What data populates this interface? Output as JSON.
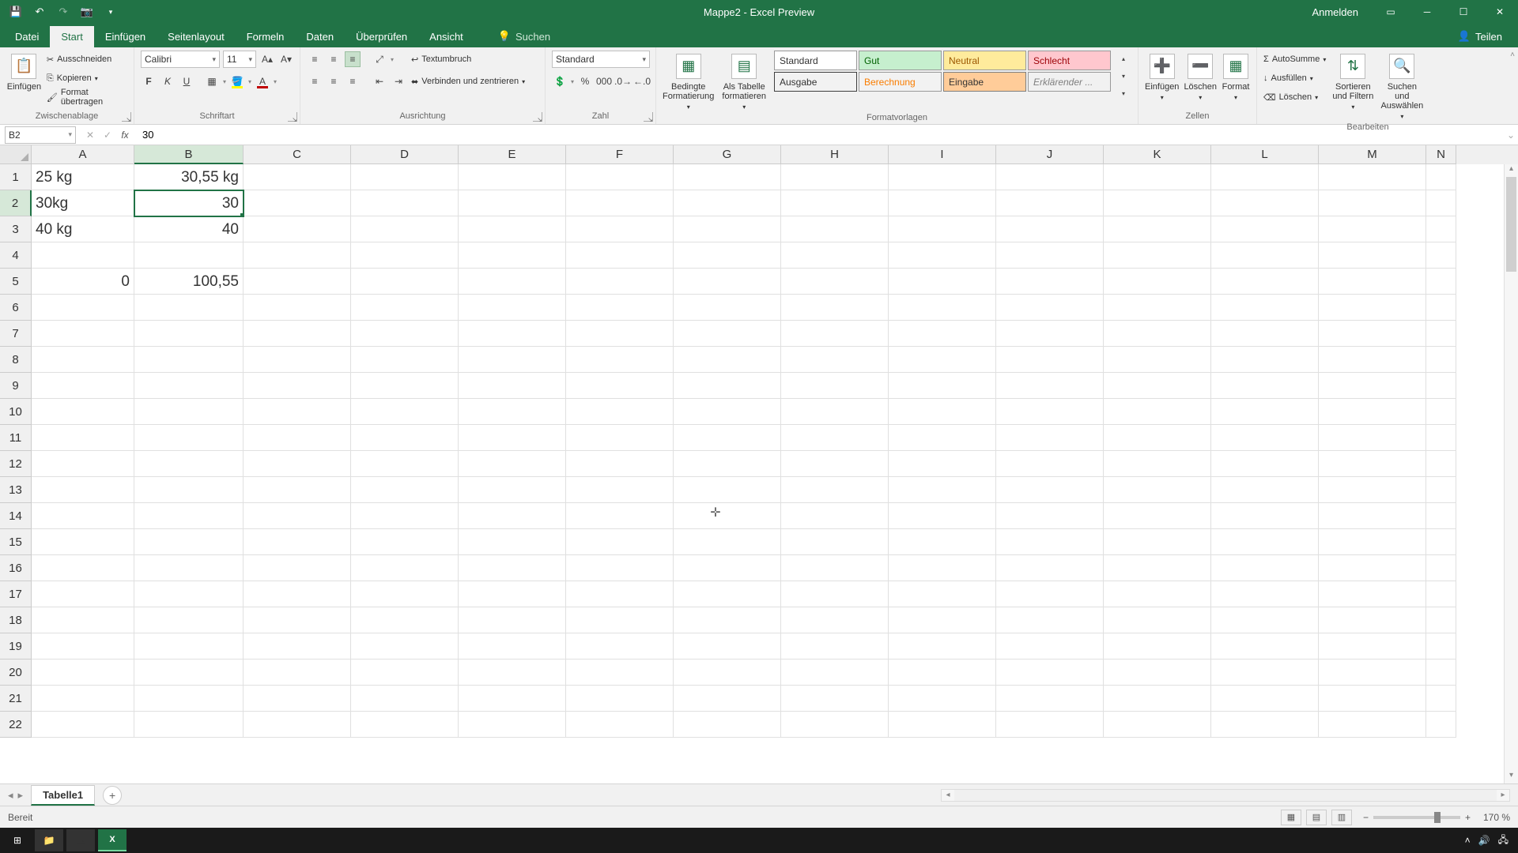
{
  "title": "Mappe2 - Excel Preview",
  "signin": "Anmelden",
  "tabs": {
    "datei": "Datei",
    "start": "Start",
    "einfuegen": "Einfügen",
    "seitenlayout": "Seitenlayout",
    "formeln": "Formeln",
    "daten": "Daten",
    "ueberpruefen": "Überprüfen",
    "ansicht": "Ansicht",
    "suchen": "Suchen",
    "teilen": "Teilen"
  },
  "ribbon": {
    "clipboard": {
      "paste": "Einfügen",
      "cut": "Ausschneiden",
      "copy": "Kopieren",
      "format_painter": "Format übertragen",
      "label": "Zwischenablage"
    },
    "font": {
      "name": "Calibri",
      "size": "11",
      "label": "Schriftart"
    },
    "alignment": {
      "wrap": "Textumbruch",
      "merge": "Verbinden und zentrieren",
      "label": "Ausrichtung"
    },
    "number": {
      "format": "Standard",
      "label": "Zahl"
    },
    "styles": {
      "cond": "Bedingte Formatierung",
      "table": "Als Tabelle formatieren",
      "s_standard": "Standard",
      "s_gut": "Gut",
      "s_neutral": "Neutral",
      "s_schlecht": "Schlecht",
      "s_ausgabe": "Ausgabe",
      "s_berechnung": "Berechnung",
      "s_eingabe": "Eingabe",
      "s_erkl": "Erklärender ...",
      "label": "Formatvorlagen"
    },
    "cells": {
      "insert": "Einfügen",
      "delete": "Löschen",
      "format": "Format",
      "label": "Zellen"
    },
    "editing": {
      "autosum": "AutoSumme",
      "fill": "Ausfüllen",
      "clear": "Löschen",
      "sort": "Sortieren und Filtern",
      "find": "Suchen und Auswählen",
      "label": "Bearbeiten"
    }
  },
  "namebox": "B2",
  "formula_value": "30",
  "columns": [
    "A",
    "B",
    "C",
    "D",
    "E",
    "F",
    "G",
    "H",
    "I",
    "J",
    "K",
    "L",
    "M",
    "N"
  ],
  "selected_col": "B",
  "selected_row": 2,
  "cells": {
    "A1": "25 kg",
    "B1": "30,55 kg",
    "A2": "30kg",
    "B2": "30",
    "A3": "40 kg",
    "B3": "40",
    "A5": "0",
    "B5": "100,55"
  },
  "sheet_tab": "Tabelle1",
  "status": "Bereit",
  "zoom": "170 %"
}
